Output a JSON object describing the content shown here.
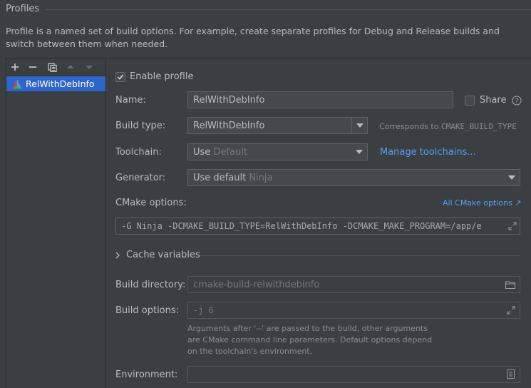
{
  "section": {
    "title": "Profiles",
    "description": "Profile is a named set of build options. For example, create separate profiles for Debug and Release builds and switch between them when needed."
  },
  "toolbar": {
    "add_icon": "plus-icon",
    "remove_icon": "minus-icon",
    "copy_icon": "copy-icon",
    "up_icon": "arrow-up-icon",
    "down_icon": "arrow-down-icon"
  },
  "profiles": [
    {
      "name": "RelWithDebInfo",
      "selected": true
    }
  ],
  "form": {
    "enable_profile_label": "Enable profile",
    "enable_profile_checked": true,
    "name_label": "Name:",
    "name_value": "RelWithDebInfo",
    "share_label": "Share",
    "share_checked": false,
    "build_type_label": "Build type:",
    "build_type_value": "RelWithDebInfo",
    "build_type_hint_prefix": "Corresponds to",
    "build_type_hint_code": "CMAKE_BUILD_TYPE",
    "toolchain_label": "Toolchain:",
    "toolchain_use": "Use",
    "toolchain_value": "Default",
    "manage_toolchains_link": "Manage toolchains...",
    "generator_label": "Generator:",
    "generator_use": "Use default",
    "generator_value": "Ninja",
    "cmake_options_label": "CMake options:",
    "all_cmake_options_link": "All CMake options ↗",
    "cmake_options_value": "-G Ninja -DCMAKE_BUILD_TYPE=RelWithDebInfo -DCMAKE_MAKE_PROGRAM=/app/e",
    "cache_variables_label": "Cache variables",
    "build_directory_label": "Build directory:",
    "build_directory_value": "cmake-build-relwithdebinfo",
    "build_options_label": "Build options:",
    "build_options_value": "-j 6",
    "build_options_help": "Arguments after '--' are passed to the build, other arguments are CMake command line parameters. Default options depend on the toolchain's environment.",
    "environment_label": "Environment:",
    "environment_value": ""
  },
  "colors": {
    "background": "#3c3f41",
    "selection": "#2f65ca",
    "link": "#589df6"
  }
}
